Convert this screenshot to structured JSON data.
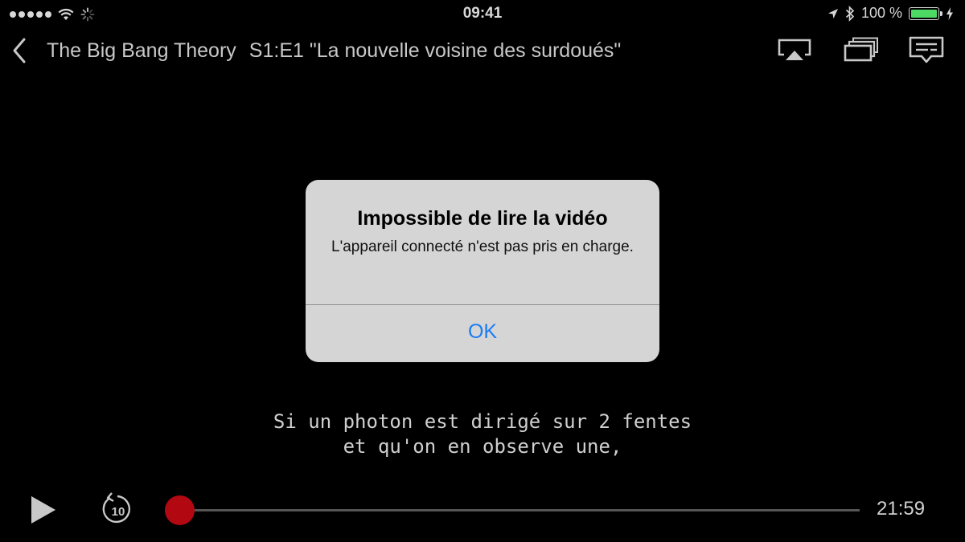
{
  "status_bar": {
    "time": "09:41",
    "battery_text": "100 %",
    "battery_level": 1.0,
    "signal_dots": 5,
    "icons": [
      "signal-dots-icon",
      "wifi-icon",
      "activity-spinner-icon",
      "location-arrow-icon",
      "bluetooth-icon",
      "battery-icon",
      "charging-bolt-icon"
    ]
  },
  "header": {
    "show_title": "The Big Bang Theory",
    "episode_title": "S1:E1 \"La nouvelle voisine des surdoués\"",
    "icons": [
      "back-chevron-icon",
      "airplay-icon",
      "episodes-icon",
      "subtitles-icon"
    ]
  },
  "alert": {
    "title": "Impossible de lire la vidéo",
    "message": "L'appareil connecté n'est pas pris en charge.",
    "ok_label": "OK"
  },
  "subtitle": {
    "line1": "Si un photon est dirigé sur 2 fentes",
    "line2": "et qu'on en observe une,"
  },
  "controls": {
    "replay_seconds": "10",
    "time_remaining": "21:59",
    "progress": 0.0,
    "icons": [
      "play-icon",
      "replay-10-icon"
    ]
  },
  "colors": {
    "accent": "#1a7cf5",
    "scrubber_knob": "#b20811",
    "battery": "#4cd964"
  }
}
